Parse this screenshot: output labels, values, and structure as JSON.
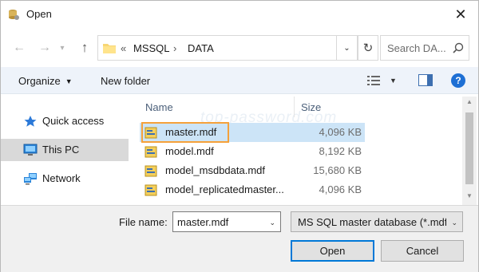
{
  "window": {
    "title": "Open"
  },
  "address": {
    "overflow": "«",
    "segments": [
      "MSSQL",
      "DATA"
    ],
    "separator": "›"
  },
  "search": {
    "placeholder": "Search DA..."
  },
  "toolbar": {
    "organize": "Organize",
    "new_folder": "New folder",
    "help": "?"
  },
  "nav": {
    "items": [
      {
        "label": "Quick access",
        "icon": "star-icon",
        "selected": false
      },
      {
        "label": "This PC",
        "icon": "computer-icon",
        "selected": true
      },
      {
        "label": "Network",
        "icon": "network-icon",
        "selected": false
      }
    ]
  },
  "files": {
    "columns": {
      "name": "Name",
      "size": "Size"
    },
    "rows": [
      {
        "name": "master.mdf",
        "size": "4,096 KB",
        "selected": true
      },
      {
        "name": "model.mdf",
        "size": "8,192 KB",
        "selected": false
      },
      {
        "name": "model_msdbdata.mdf",
        "size": "15,680 KB",
        "selected": false
      },
      {
        "name": "model_replicatedmaster...",
        "size": "4,096 KB",
        "selected": false
      }
    ]
  },
  "watermark": "top-password.com",
  "bottom": {
    "file_name_label": "File name:",
    "file_name_value": "master.mdf",
    "file_type_value": "MS SQL master database (*.mdf)",
    "open_label": "Open",
    "cancel_label": "Cancel"
  },
  "colors": {
    "accent": "#0078d7",
    "selection": "#cce4f7",
    "focus": "#f5a13a"
  }
}
